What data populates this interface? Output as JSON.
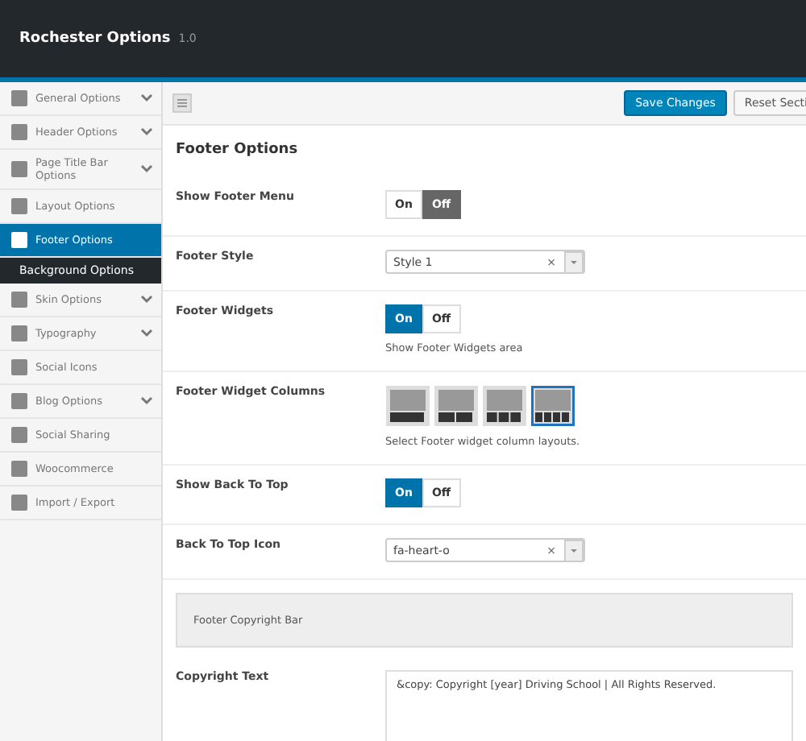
{
  "header": {
    "title": "Rochester Options",
    "version": "1.0"
  },
  "sidebar": {
    "items": [
      {
        "label": "General Options",
        "expandable": true,
        "selected": false
      },
      {
        "label": "Header Options",
        "expandable": true,
        "selected": false
      },
      {
        "label": "Page Title Bar Options",
        "expandable": true,
        "selected": false
      },
      {
        "label": "Layout Options",
        "expandable": false,
        "selected": false
      },
      {
        "label": "Footer Options",
        "expandable": false,
        "selected": true,
        "children": [
          {
            "label": "Background Options",
            "selected": false
          }
        ]
      },
      {
        "label": "Skin Options",
        "expandable": true,
        "selected": false
      },
      {
        "label": "Typography",
        "expandable": true,
        "selected": false
      },
      {
        "label": "Social Icons",
        "expandable": false,
        "selected": false
      },
      {
        "label": "Blog Options",
        "expandable": true,
        "selected": false
      },
      {
        "label": "Social Sharing",
        "expandable": false,
        "selected": false
      },
      {
        "label": "Woocommerce",
        "expandable": false,
        "selected": false
      },
      {
        "label": "Import / Export",
        "expandable": false,
        "selected": false
      }
    ]
  },
  "toolbar": {
    "buttons": [
      {
        "label": "Save Changes",
        "kind": "primary"
      },
      {
        "label": "Reset Secti",
        "kind": "secondary"
      }
    ]
  },
  "section_title": "Footer Options",
  "fields": [
    {
      "kind": "toggle",
      "label": "Show Footer Menu",
      "on_label": "On",
      "off_label": "Off",
      "on": false
    },
    {
      "kind": "select",
      "label": "Footer Style",
      "value": "Style 1",
      "clear": "×"
    },
    {
      "kind": "toggle",
      "label": "Footer Widgets",
      "on_label": "On",
      "off_label": "Off",
      "on": true,
      "description": "Show Footer Widgets area"
    },
    {
      "kind": "layouts",
      "label": "Footer Widget Columns",
      "options": [
        {
          "kind": "one",
          "selected": false
        },
        {
          "kind": "two",
          "selected": false
        },
        {
          "kind": "three",
          "selected": false
        },
        {
          "kind": "four",
          "selected": true
        }
      ],
      "description": "Select Footer widget column layouts."
    },
    {
      "kind": "toggle",
      "label": "Show Back To Top",
      "on_label": "On",
      "off_label": "Off",
      "on": true
    },
    {
      "kind": "select",
      "label": "Back To Top Icon",
      "value": "fa-heart-o",
      "clear": "×"
    },
    {
      "kind": "heading",
      "label": "Footer Copyright Bar"
    },
    {
      "kind": "textarea",
      "label": "Copyright Text",
      "value": "&copy: Copyright [year] Driving School | All Rights Reserved."
    }
  ]
}
